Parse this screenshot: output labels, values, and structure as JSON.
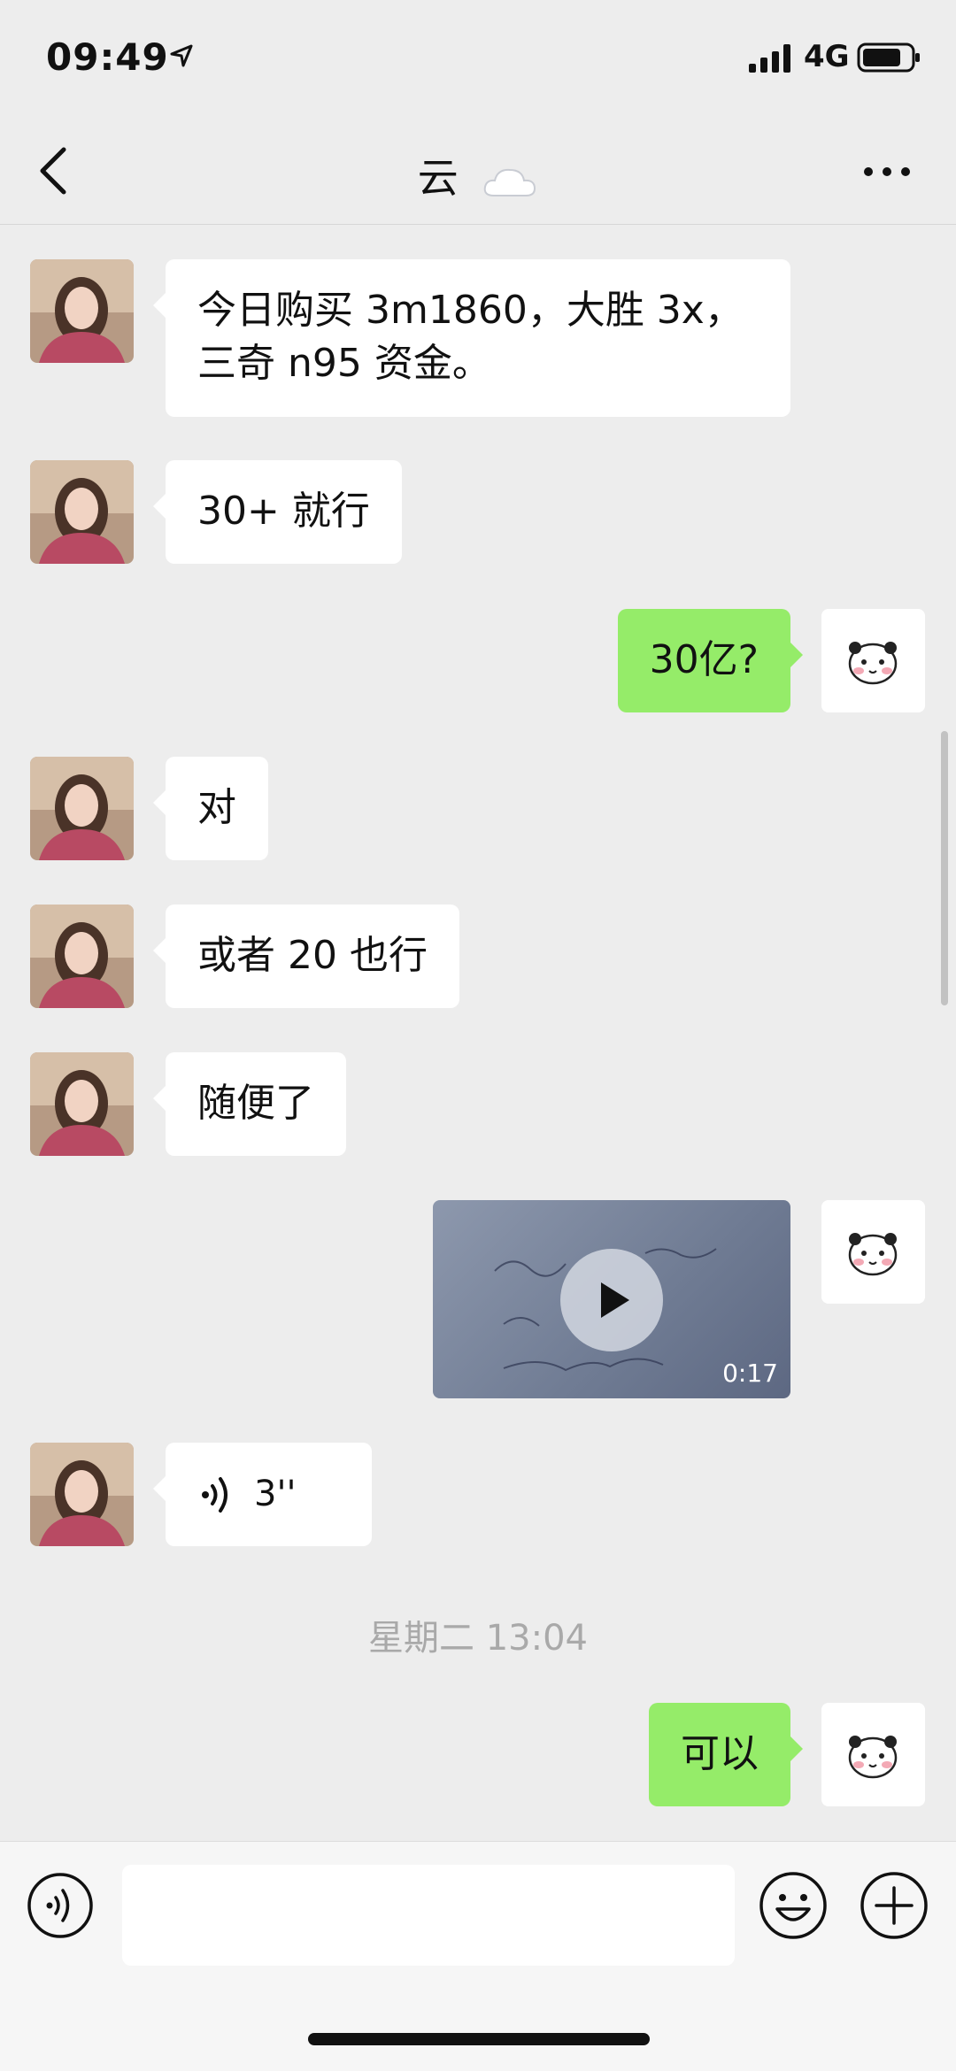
{
  "status_bar": {
    "time": "09:49",
    "network": "4G"
  },
  "header": {
    "title": "云"
  },
  "messages": [
    {
      "side": "left",
      "text": "今日购买 3m1860，大胜 3x，\n三奇 n95 资金。"
    },
    {
      "side": "left",
      "text": "30+ 就行"
    },
    {
      "side": "right",
      "text": "30亿?"
    },
    {
      "side": "left",
      "text": "对"
    },
    {
      "side": "left",
      "text": "或者 20 也行"
    },
    {
      "side": "left",
      "text": "随便了"
    },
    {
      "side": "right",
      "type": "video",
      "duration": "0:17"
    },
    {
      "side": "left",
      "type": "voice",
      "duration": "3''"
    },
    {
      "side": "right",
      "text": "可以"
    }
  ],
  "timestamp": "星期二 13:04",
  "icons": {
    "back": "chevron-left-icon",
    "more": "more-dots-icon",
    "voice": "voice-wave-icon",
    "emoji": "smiley-icon",
    "plus": "plus-icon",
    "play": "play-icon"
  },
  "colors": {
    "background": "#ededed",
    "sent_bubble": "#95ec69",
    "received_bubble": "#ffffff"
  }
}
